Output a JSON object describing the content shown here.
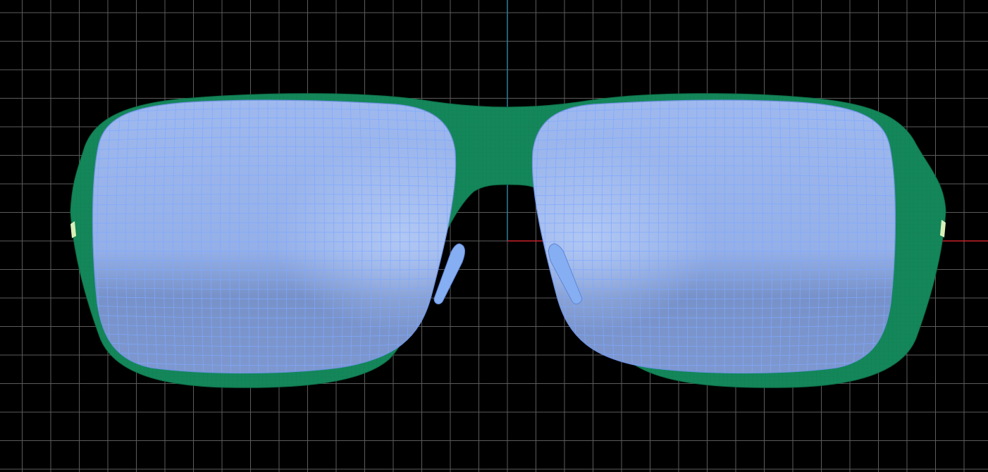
{
  "viewport": {
    "background_color": "#000000",
    "grid_color": "#5c5c5c",
    "axis_x_color": "#c8202a",
    "axis_y_color": "#2d7f96"
  },
  "model": {
    "frame_color": "#14875a",
    "frame_mesh_color": "#0f6f49",
    "lens_color": "#9ab4ec",
    "lens_shade_color": "#7690c8",
    "lens_mesh_color": "#7ea8ff",
    "nose_pad_color": "#86aef2",
    "hinge_color": "#d8f0b8"
  },
  "icons": {
    "grid": "grid-icon",
    "axis": "axis-icon"
  }
}
